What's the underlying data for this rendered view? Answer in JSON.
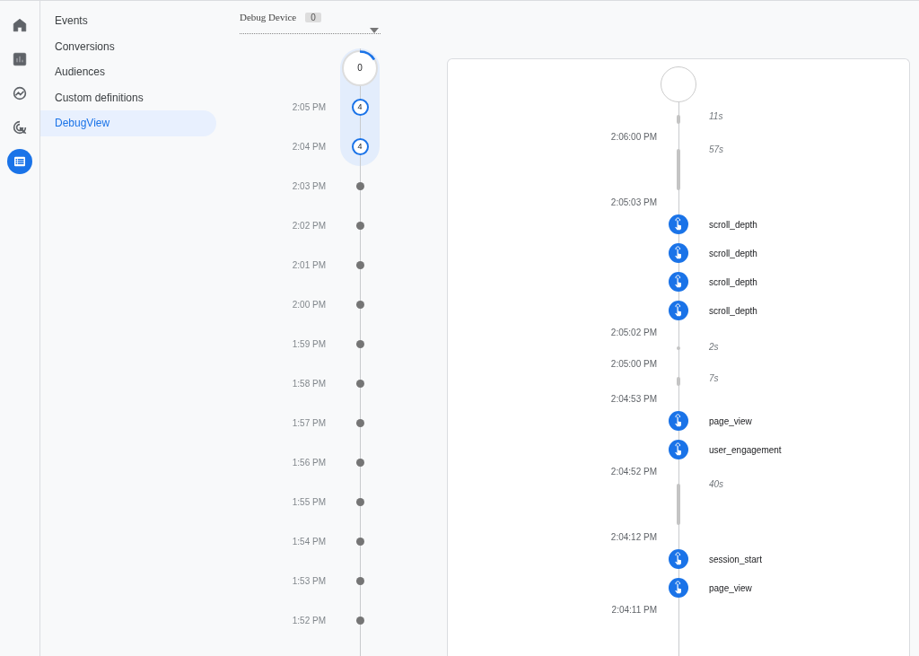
{
  "rail": [
    {
      "kind": "home",
      "selected": false
    },
    {
      "kind": "reports",
      "selected": false
    },
    {
      "kind": "explore",
      "selected": false
    },
    {
      "kind": "advertising",
      "selected": false
    },
    {
      "kind": "configure",
      "selected": true
    }
  ],
  "nav": [
    {
      "label": "Events",
      "selected": false
    },
    {
      "label": "Conversions",
      "selected": false
    },
    {
      "label": "Audiences",
      "selected": false
    },
    {
      "label": "Custom definitions",
      "selected": false
    },
    {
      "label": "DebugView",
      "selected": true
    }
  ],
  "device": {
    "label": "Debug Device",
    "count": "0"
  },
  "minutes": {
    "top_count": "0",
    "items": [
      {
        "time": "2:05 PM",
        "count": "4"
      },
      {
        "time": "2:04 PM",
        "count": "4"
      },
      {
        "time": "2:03 PM"
      },
      {
        "time": "2:02 PM"
      },
      {
        "time": "2:01 PM"
      },
      {
        "time": "2:00 PM"
      },
      {
        "time": "1:59 PM"
      },
      {
        "time": "1:58 PM"
      },
      {
        "time": "1:57 PM"
      },
      {
        "time": "1:56 PM"
      },
      {
        "time": "1:55 PM"
      },
      {
        "time": "1:54 PM"
      },
      {
        "time": "1:53 PM"
      },
      {
        "time": "1:52 PM"
      }
    ]
  },
  "seconds": [
    {
      "kind": "start"
    },
    {
      "kind": "short_gap",
      "duration": "11s"
    },
    {
      "kind": "time",
      "time": "2:06:00 PM"
    },
    {
      "kind": "long_gap",
      "duration": "57s"
    },
    {
      "kind": "time",
      "time": "2:05:03 PM"
    },
    {
      "kind": "event",
      "name": "scroll_depth"
    },
    {
      "kind": "event",
      "name": "scroll_depth"
    },
    {
      "kind": "event",
      "name": "scroll_depth"
    },
    {
      "kind": "event",
      "name": "scroll_depth"
    },
    {
      "kind": "time",
      "time": "2:05:02 PM"
    },
    {
      "kind": "dot_gap",
      "duration": "2s"
    },
    {
      "kind": "time",
      "time": "2:05:00 PM"
    },
    {
      "kind": "short_gap",
      "duration": "7s"
    },
    {
      "kind": "time",
      "time": "2:04:53 PM"
    },
    {
      "kind": "event",
      "name": "page_view"
    },
    {
      "kind": "event",
      "name": "user_engagement"
    },
    {
      "kind": "time",
      "time": "2:04:52 PM"
    },
    {
      "kind": "long_gap",
      "duration": "40s"
    },
    {
      "kind": "time",
      "time": "2:04:12 PM"
    },
    {
      "kind": "event",
      "name": "session_start"
    },
    {
      "kind": "event",
      "name": "page_view"
    },
    {
      "kind": "time",
      "time": "2:04:11 PM"
    }
  ]
}
